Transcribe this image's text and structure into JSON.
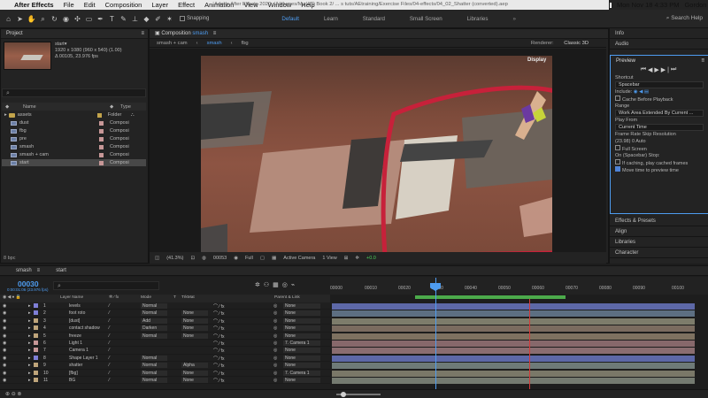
{
  "menubar": {
    "apple": "",
    "app": "After Effects",
    "items": [
      "File",
      "Edit",
      "Composition",
      "Layer",
      "Effect",
      "Animation",
      "View",
      "Window",
      "Help"
    ],
    "clock": "Mon Nov 18  4:33 PM",
    "user": "Gordon Tandrup"
  },
  "toolbar": {
    "snapping": "Snapping",
    "workspaces": [
      "Default",
      "Learn",
      "Standard",
      "Small Screen",
      "Libraries"
    ],
    "active_workspace": "Default",
    "overflow": "»",
    "search_help": "Search Help",
    "doc_title": "Adobe After Effects 2020 - /Volumes/My WD Book 2/ ... s tuts/AEtraining/Exercise Files/04-effects/04_02_Shatter (converted).aep"
  },
  "project": {
    "title": "Project",
    "thumb_name": "start▾",
    "thumb_info1": "1920 x 1080  (960 x 540) (1.00)",
    "thumb_info2": "Δ 00105, 23.976 fps",
    "header_name": "Name",
    "header_type": "Type",
    "items": [
      {
        "name": "assets",
        "type": "Folder",
        "kind": "folder"
      },
      {
        "name": "dust",
        "type": "Composi",
        "kind": "comp"
      },
      {
        "name": "fbg",
        "type": "Composi",
        "kind": "comp"
      },
      {
        "name": "pre",
        "type": "Composi",
        "kind": "comp"
      },
      {
        "name": "smash",
        "type": "Composi",
        "kind": "comp"
      },
      {
        "name": "smash + cam",
        "type": "Composi",
        "kind": "comp"
      },
      {
        "name": "start",
        "type": "Composi",
        "kind": "comp",
        "selected": true
      }
    ],
    "bpc": "8 bpc"
  },
  "composition": {
    "panel_title": "Composition",
    "panel_comp": "smash",
    "tabs": [
      "smash + cam",
      "smash",
      "fbg"
    ],
    "active_tab": "smash",
    "renderer_label": "Renderer:",
    "renderer_value": "Classic 3D",
    "display_label": "Display",
    "zoom": "(41.3%)",
    "frame": "00053",
    "resolution": "Full",
    "camera": "Active Camera",
    "views": "1 View",
    "exposure": "+0.0"
  },
  "right_panel": {
    "info": "Info",
    "audio": "Audio",
    "preview_title": "Preview",
    "shortcut_label": "Shortcut",
    "shortcut_value": "Spacebar",
    "include_label": "Include:",
    "cache_before": "Cache Before Playback",
    "range_label": "Range",
    "range_value": "Work Area Extended By Current ...",
    "play_from_label": "Play From",
    "play_from_value": "Current Time",
    "frame_rate_label": "Frame Rate",
    "skip_label": "Skip",
    "resolution_label": "Resolution",
    "frame_rate_value": "(23.98)",
    "skip_value": "0",
    "resolution_value": "Auto",
    "full_screen": "Full Screen",
    "on_stop_label": "On (Spacebar) Stop:",
    "on_stop_cache": "If caching, play cached frames",
    "on_stop_move": "Move time to preview time",
    "effects_presets": "Effects & Presets",
    "align": "Align",
    "libraries": "Libraries",
    "character": "Character"
  },
  "timeline": {
    "tabs": [
      "smash",
      "start"
    ],
    "timecode": "00030",
    "timecode_sub": "0:00:01:06 (23.976 fps)",
    "columns": {
      "layer_name": "Layer Name",
      "mode": "Mode",
      "t": "T",
      "trkmat": "TrkMat",
      "parent": "Parent & Link"
    },
    "ruler_ticks": [
      "00000",
      "00010",
      "00020",
      "00030",
      "00040",
      "00050",
      "00060",
      "00070",
      "00080",
      "00090",
      "00100"
    ],
    "layers": [
      {
        "num": "1",
        "name": "levels",
        "mode": "Normal",
        "trkmat": "",
        "parent": "None",
        "color": "#7f7fd6",
        "bar": "#5d68a7"
      },
      {
        "num": "2",
        "name": "foot roto",
        "mode": "Normal",
        "trkmat": "None",
        "parent": "None",
        "color": "#7f7fd6",
        "bar": "#5d6f82"
      },
      {
        "num": "3",
        "name": "[dust]",
        "mode": "Add",
        "trkmat": "None",
        "parent": "None",
        "color": "#bfa57b",
        "bar": "#7d7c6b"
      },
      {
        "num": "4",
        "name": "contact shadow",
        "mode": "Darken",
        "trkmat": "None",
        "parent": "None",
        "color": "#bfa57b",
        "bar": "#7a6b5f"
      },
      {
        "num": "5",
        "name": "freeze",
        "mode": "Normal",
        "trkmat": "None",
        "parent": "None",
        "color": "#bfa57b",
        "bar": "#7e7160"
      },
      {
        "num": "6",
        "name": "Light 1",
        "mode": "",
        "trkmat": "",
        "parent": "7. Camera 1",
        "color": "#c79797",
        "bar": "#87686b"
      },
      {
        "num": "7",
        "name": "Camera 1",
        "mode": "",
        "trkmat": "",
        "parent": "None",
        "color": "#c79797",
        "bar": "#8a6d70"
      },
      {
        "num": "8",
        "name": "Shape Layer 1",
        "mode": "Normal",
        "trkmat": "",
        "parent": "None",
        "color": "#7f7fd6",
        "bar": "#5d68a7"
      },
      {
        "num": "9",
        "name": "shatter",
        "mode": "Normal",
        "trkmat": "Alpha",
        "parent": "None",
        "color": "#bfa57b",
        "bar": "#6e7a78"
      },
      {
        "num": "10",
        "name": "[fbg]",
        "mode": "Normal",
        "trkmat": "None",
        "parent": "7. Camera 1",
        "color": "#bfa57b",
        "bar": "#7a7868"
      },
      {
        "num": "11",
        "name": "BG",
        "mode": "Normal",
        "trkmat": "None",
        "parent": "None",
        "color": "#bfa57b",
        "bar": "#747a70"
      }
    ]
  }
}
